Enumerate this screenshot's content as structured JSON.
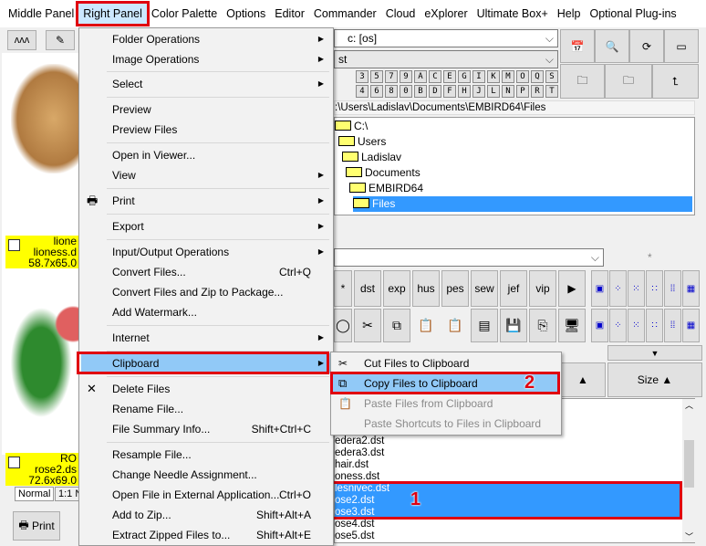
{
  "menubar": [
    {
      "label": "Middle Panel"
    },
    {
      "label": "Right Panel",
      "active": true
    },
    {
      "label": "Color Palette"
    },
    {
      "label": "Options"
    },
    {
      "label": "Editor"
    },
    {
      "label": "Commander"
    },
    {
      "label": "Cloud"
    },
    {
      "label": "eXplorer"
    },
    {
      "label": "Ultimate Box+"
    },
    {
      "label": "Help"
    },
    {
      "label": "Optional Plug-ins"
    }
  ],
  "left_panel": {
    "items": [
      {
        "title": "lione",
        "file": "lioness.d",
        "size": "58.7x65.0"
      },
      {
        "title": "RO",
        "file": "rose2.ds",
        "size": "72.6x69.0"
      }
    ],
    "tabs": [
      "Normal",
      "1:1 N"
    ],
    "print_label": "Print"
  },
  "menu": {
    "items": [
      {
        "label": "Folder Operations",
        "submenu": true
      },
      {
        "label": "Image Operations",
        "submenu": true
      },
      {
        "label": "Select",
        "submenu": true
      },
      {
        "label": "Preview"
      },
      {
        "label": "Preview Files"
      },
      {
        "label": "Open in Viewer..."
      },
      {
        "label": "View",
        "submenu": true
      },
      {
        "label": "Print",
        "submenu": true,
        "icon": "printer-icon"
      },
      {
        "label": "Export",
        "submenu": true
      },
      {
        "label": "Input/Output Operations",
        "submenu": true
      },
      {
        "label": "Convert Files...",
        "shortcut": "Ctrl+Q"
      },
      {
        "label": "Convert Files and Zip to Package..."
      },
      {
        "label": "Add Watermark..."
      },
      {
        "label": "Internet",
        "submenu": true
      },
      {
        "label": "Clipboard",
        "submenu": true,
        "highlighted": true
      },
      {
        "label": "Delete Files",
        "icon": "delete-icon"
      },
      {
        "label": "Rename File..."
      },
      {
        "label": "File Summary Info...",
        "shortcut": "Shift+Ctrl+C"
      },
      {
        "label": "Resample File..."
      },
      {
        "label": "Change Needle Assignment..."
      },
      {
        "label": "Open File in External Application...",
        "shortcut": "Ctrl+O"
      },
      {
        "label": "Add to Zip...",
        "shortcut": "Shift+Alt+A"
      },
      {
        "label": "Extract Zipped Files to...",
        "shortcut": "Shift+Alt+E"
      }
    ]
  },
  "submenu": {
    "items": [
      {
        "label": "Cut Files to Clipboard",
        "icon": "scissors-icon"
      },
      {
        "label": "Copy Files to Clipboard",
        "icon": "copy-icon",
        "highlighted": true
      },
      {
        "label": "Paste Files from Clipboard",
        "icon": "paste-icon",
        "disabled": true
      },
      {
        "label": "Paste Shortcuts to Files in Clipboard",
        "disabled": true
      }
    ]
  },
  "annotations": {
    "step1": "1",
    "step2": "2"
  },
  "right_panel": {
    "drive": "c: [os]",
    "filter": "st",
    "keys_row1": [
      "3",
      "5",
      "7",
      "9",
      "A",
      "C",
      "E",
      "G",
      "I",
      "K",
      "M",
      "O",
      "Q",
      "S",
      "▶"
    ],
    "keys_row2": [
      "4",
      "6",
      "8",
      "0",
      "B",
      "D",
      "F",
      "H",
      "J",
      "L",
      "N",
      "P",
      "R",
      "T",
      "▼"
    ],
    "path": ":\\Users\\Ladislav\\Documents\\EMBIRD64\\Files",
    "tree": [
      "C:\\",
      "Users",
      "Ladislav",
      "Documents",
      "EMBIRD64",
      "Files"
    ],
    "tree_selected": "Files",
    "wildcard": "*",
    "ext_buttons": [
      "*",
      "dst",
      "exp",
      "hus",
      "pes",
      "sew",
      "jef",
      "vip",
      "▶"
    ],
    "column_header": "Size ▲",
    "files": [
      {
        "name": "edera2.dst"
      },
      {
        "name": "edera3.dst"
      },
      {
        "name": "hair.dst"
      },
      {
        "name": "oness.dst"
      },
      {
        "name": "lesnivec.dst",
        "selected": true
      },
      {
        "name": "ose2.dst",
        "selected": true
      },
      {
        "name": "ose3.dst",
        "selected": true
      },
      {
        "name": "ose4.dst"
      },
      {
        "name": "ose5.dst"
      }
    ]
  },
  "colors": {
    "highlight": "#91c9f7",
    "selection": "#3399ff",
    "annotation": "#e00010",
    "label_bg": "#ffff00"
  }
}
